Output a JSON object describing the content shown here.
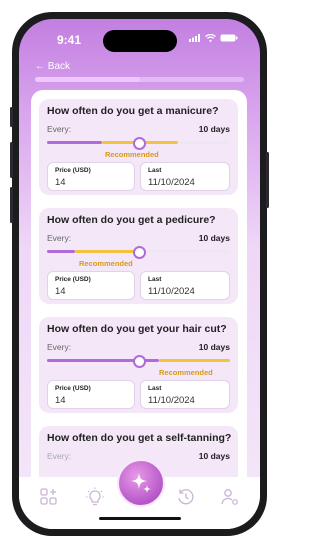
{
  "status": {
    "time": "9:41"
  },
  "nav": {
    "back_label": "← Back"
  },
  "colors": {
    "purple": "#b06ad9",
    "yellow": "#f3c23e",
    "recommended": "#d89a1a"
  },
  "cards": [
    {
      "question": "How often do you get a manicure?",
      "every_label": "Every:",
      "days": "10 days",
      "slider_value": 0.5,
      "recommended_label": "Recommended",
      "price_label": "Price (USD)",
      "price_value": "14",
      "last_label": "Last",
      "last_value": "11/10/2024"
    },
    {
      "question": "How often do you get a pedicure?",
      "every_label": "Every:",
      "days": "10 days",
      "slider_value": 0.5,
      "recommended_label": "Recommended",
      "price_label": "Price (USD)",
      "price_value": "14",
      "last_label": "Last",
      "last_value": "11/10/2024"
    },
    {
      "question": "How often do you get your hair cut?",
      "every_label": "Every:",
      "days": "10 days",
      "slider_value": 0.5,
      "recommended_label": "Recommended",
      "price_label": "Price (USD)",
      "price_value": "14",
      "last_label": "Last",
      "last_value": "11/10/2024"
    },
    {
      "question": "How often do you get a self-tanning?",
      "every_label": "Every:",
      "days": "10 days"
    }
  ],
  "tabbar": {
    "icons": [
      "grid-add-icon",
      "lightbulb-icon",
      "sparkle-icon",
      "history-icon",
      "user-settings-icon"
    ]
  }
}
